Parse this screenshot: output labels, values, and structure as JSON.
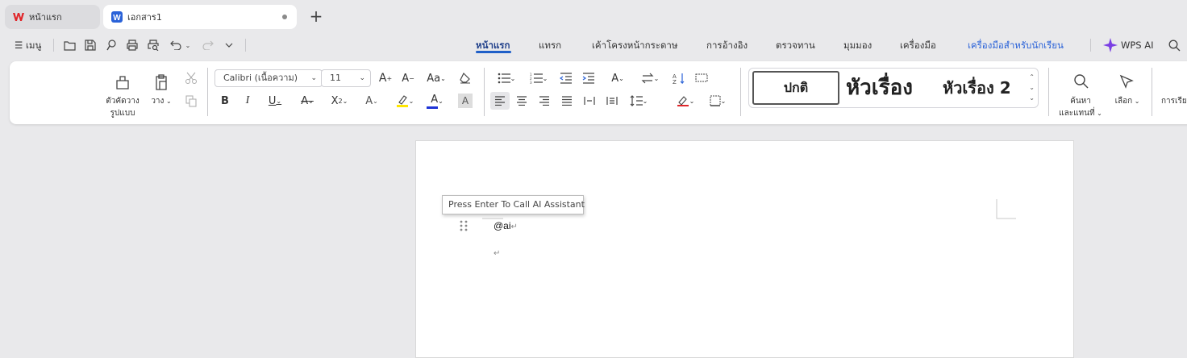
{
  "tabs": {
    "home": "หน้าแรก",
    "doc": "เอกสาร1"
  },
  "menu": {
    "hamburger_label": "เมนู",
    "items": [
      "หน้าแรก",
      "แทรก",
      "เค้าโครงหน้ากระดาษ",
      "การอ้างอิง",
      "ตรวจทาน",
      "มุมมอง",
      "เครื่องมือ",
      "เครื่องมือสำหรับนักเรียน"
    ],
    "wps_ai": "WPS AI"
  },
  "ribbon": {
    "format_painter": [
      "ตัวคัดวาง",
      "รูปแบบ"
    ],
    "paste": "วาง",
    "font_name": "Calibri (เนื้อความ)",
    "font_size": "11",
    "style_normal": "ปกติ",
    "style_heading1": "หัวเรื่อง",
    "style_heading2": "หัวเรื่อง 2",
    "find_replace": [
      "ค้นหา",
      "และแทนที่"
    ],
    "select": "เลือก",
    "arrange": "การเรีย"
  },
  "document": {
    "tooltip": "Press Enter To Call AI Assistant",
    "line1": "@ai"
  },
  "colors": {
    "accent": "#1f5fc8",
    "wps_red": "#e0262a",
    "doc_blue": "#2a62d8",
    "highlight_yellow": "#ffe600",
    "font_color_blue": "#1e33d6",
    "ai_purple": "#7b3fe4"
  }
}
